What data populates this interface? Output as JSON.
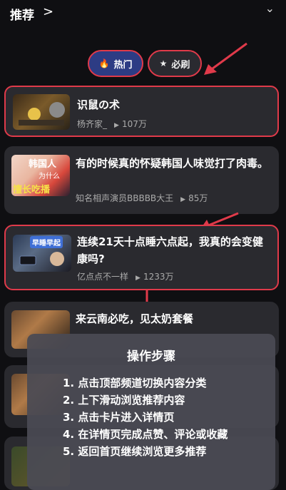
{
  "header": {
    "title": "推荐",
    "chevron_right": ">",
    "chevron_down": "⌄"
  },
  "tabs": [
    {
      "label": "热门",
      "icon": "flame-icon"
    },
    {
      "label": "必刷",
      "icon": "star-icon"
    }
  ],
  "cards": [
    {
      "title": "识鼠の术",
      "author": "杨齐家_",
      "plays": "107万"
    },
    {
      "title": "有的时候真的怀疑韩国人味觉打了肉毒。",
      "author": "知名相声演员BBBBB大王",
      "plays": "85万",
      "thumb_text_1": "韩国人",
      "thumb_text_2": "为什么",
      "thumb_text_3": "擅长吃播"
    },
    {
      "title": "连续21天十点睡六点起，我真的会变健康吗?",
      "author": "亿点点不一样",
      "plays": "1233万",
      "thumb_text": "早睡早起"
    },
    {
      "title": "来云南必吃，见太奶套餐"
    }
  ],
  "overlay": {
    "title": "操作步骤",
    "steps": [
      "1. 点击顶部频道切换内容分类",
      "2. 上下滑动浏览推荐内容",
      "3. 点击卡片进入详情页",
      "4. 在详情页完成点赞、评论或收藏",
      "5. 返回首页继续浏览更多推荐"
    ]
  },
  "colors": {
    "highlight": "#e03a4a",
    "hot_tab_bg": "#2d3c84",
    "card_bg": "#2a2a2f",
    "page_bg": "#0f0f12"
  }
}
